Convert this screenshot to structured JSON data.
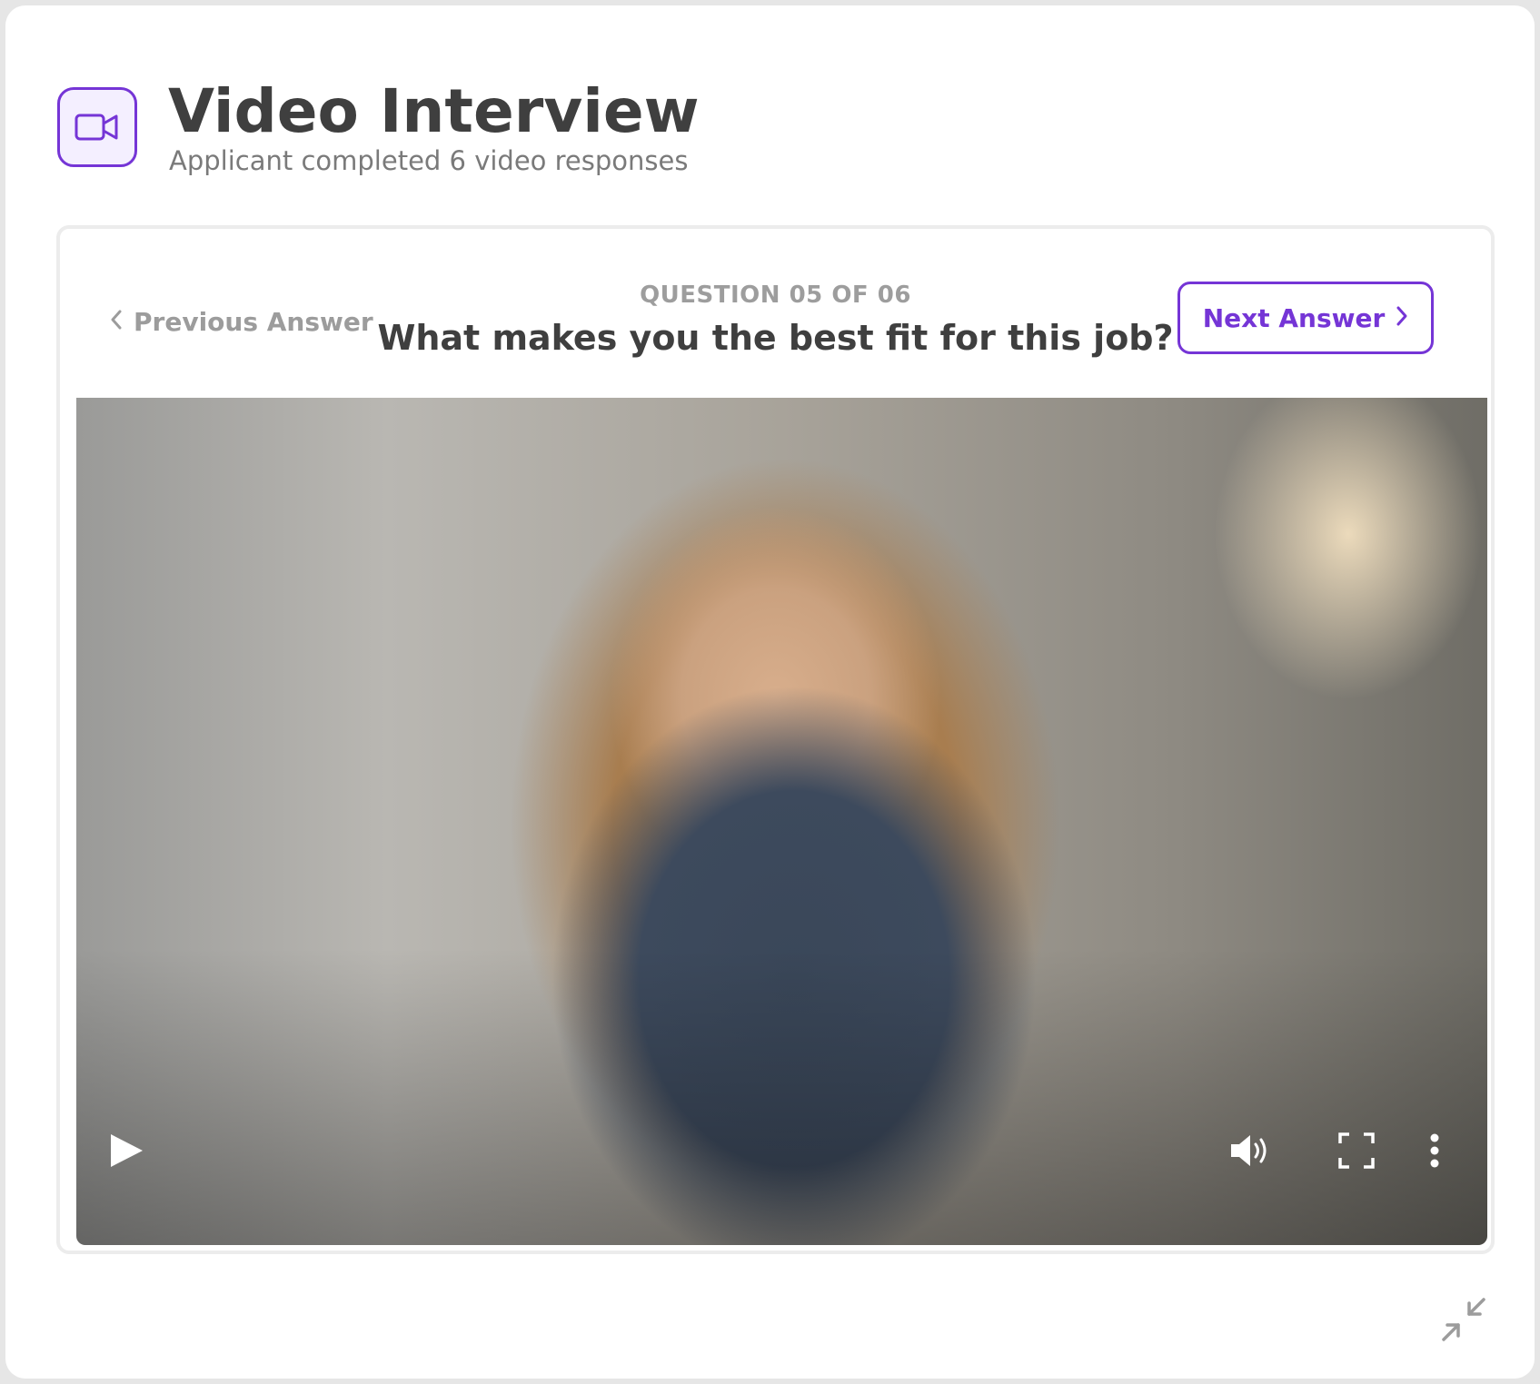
{
  "header": {
    "icon": "video-camera-icon",
    "title": "Video Interview",
    "subtitle": "Applicant completed 6 video responses"
  },
  "navigation": {
    "previous_label": "Previous Answer",
    "next_label": "Next Answer",
    "question_counter": "QUESTION 05 OF 06",
    "question_text": "What makes you the best fit for this job?"
  },
  "video_controls": {
    "play_icon": "play-icon",
    "volume_icon": "volume-icon",
    "fullscreen_icon": "fullscreen-icon",
    "more_icon": "more-vertical-icon"
  },
  "footer": {
    "collapse_icon": "collapse-icon"
  },
  "colors": {
    "accent": "#7535d6",
    "title_text": "#3f3f3f",
    "muted_text": "#9c9c9c"
  }
}
